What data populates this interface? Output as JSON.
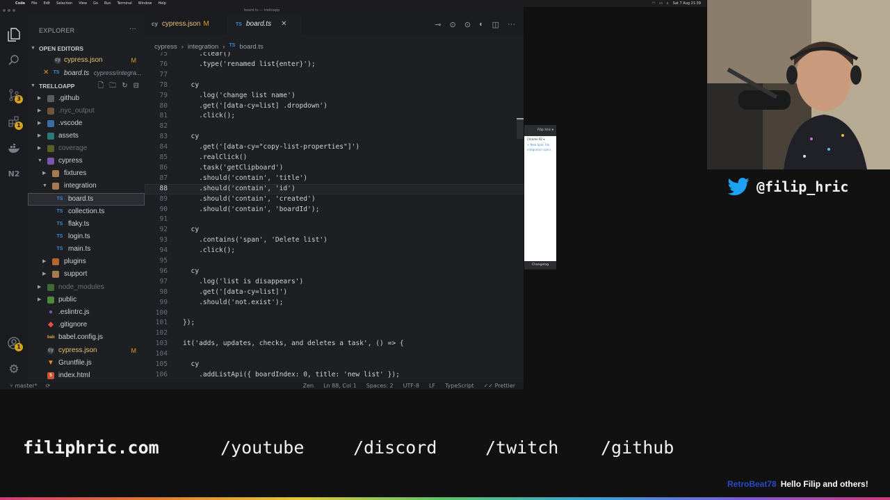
{
  "menubar": {
    "items": [
      "Code",
      "File",
      "Edit",
      "Selection",
      "View",
      "Go",
      "Run",
      "Terminal",
      "Window",
      "Help"
    ],
    "clock": "Sat 7 Aug 21:39"
  },
  "window_title": "board.ts — trelloapp",
  "sidebar": {
    "title": "EXPLORER",
    "open_editors_label": "OPEN EDITORS",
    "open_editors": [
      {
        "icon": "cy",
        "name": "cypress.json",
        "status": "M",
        "path": ""
      },
      {
        "icon": "TS",
        "name": "board.ts",
        "status": "",
        "path": "cypress/integra..."
      }
    ],
    "project_label": "TRELLOAPP",
    "tree": [
      {
        "name": ".github",
        "icon": "folder-github",
        "depth": 1,
        "type": "folder"
      },
      {
        "name": ".nyc_output",
        "icon": "folder",
        "depth": 1,
        "type": "folder"
      },
      {
        "name": ".vscode",
        "icon": "folder-vscode",
        "depth": 1,
        "type": "folder"
      },
      {
        "name": "assets",
        "icon": "folder-assets",
        "depth": 1,
        "type": "folder"
      },
      {
        "name": "coverage",
        "icon": "folder-coverage",
        "depth": 1,
        "type": "folder"
      },
      {
        "name": "cypress",
        "icon": "folder-cypress",
        "depth": 1,
        "type": "folder-open"
      },
      {
        "name": "fixtures",
        "icon": "folder",
        "depth": 2,
        "type": "folder"
      },
      {
        "name": "integration",
        "icon": "folder",
        "depth": 2,
        "type": "folder-open"
      },
      {
        "name": "board.ts",
        "icon": "TS",
        "depth": 3,
        "type": "file"
      },
      {
        "name": "collection.ts",
        "icon": "TS",
        "depth": 3,
        "type": "file"
      },
      {
        "name": "flaky.ts",
        "icon": "TS",
        "depth": 3,
        "type": "file"
      },
      {
        "name": "login.ts",
        "icon": "TS",
        "depth": 3,
        "type": "file"
      },
      {
        "name": "main.ts",
        "icon": "TS",
        "depth": 3,
        "type": "file"
      },
      {
        "name": "plugins",
        "icon": "folder-plugins",
        "depth": 2,
        "type": "folder"
      },
      {
        "name": "support",
        "icon": "folder",
        "depth": 2,
        "type": "folder"
      },
      {
        "name": "node_modules",
        "icon": "folder-node",
        "depth": 1,
        "type": "folder"
      },
      {
        "name": "public",
        "icon": "folder-public",
        "depth": 1,
        "type": "folder"
      },
      {
        "name": ".eslintrc.js",
        "icon": "eslint",
        "depth": 1,
        "type": "file"
      },
      {
        "name": ".gitignore",
        "icon": "git",
        "depth": 1,
        "type": "file"
      },
      {
        "name": "babel.config.js",
        "icon": "babel",
        "depth": 1,
        "type": "file"
      },
      {
        "name": "cypress.json",
        "icon": "cy",
        "depth": 1,
        "type": "file",
        "status": "M"
      },
      {
        "name": "Gruntfile.js",
        "icon": "grunt",
        "depth": 1,
        "type": "file"
      },
      {
        "name": "index.html",
        "icon": "html",
        "depth": 1,
        "type": "file"
      }
    ]
  },
  "tabs": [
    {
      "icon": "cy",
      "label": "cypress.json",
      "status": "M"
    },
    {
      "icon": "TS",
      "label": "board.ts",
      "close": "✕"
    }
  ],
  "breadcrumb": [
    "cypress",
    "integration",
    "TS",
    "board.ts"
  ],
  "code": [
    {
      "n": "75",
      "t": "    .clear()"
    },
    {
      "n": "76",
      "t": "    .type('renamed list{enter}');"
    },
    {
      "n": "77",
      "t": ""
    },
    {
      "n": "78",
      "t": "  cy"
    },
    {
      "n": "79",
      "t": "    .log('change list name')"
    },
    {
      "n": "80",
      "t": "    .get('[data-cy=list] .dropdown')"
    },
    {
      "n": "81",
      "t": "    .click();"
    },
    {
      "n": "82",
      "t": ""
    },
    {
      "n": "83",
      "t": "  cy"
    },
    {
      "n": "84",
      "t": "    .get('[data-cy=\"copy-list-properties\"]')"
    },
    {
      "n": "85",
      "t": "    .realClick()"
    },
    {
      "n": "86",
      "t": "    .task('getClipboard')"
    },
    {
      "n": "87",
      "t": "    .should('contain', 'title')"
    },
    {
      "n": "88",
      "t": "    .should('contain', 'id')"
    },
    {
      "n": "89",
      "t": "    .should('contain', 'created')"
    },
    {
      "n": "90",
      "t": "    .should('contain', 'boardId');"
    },
    {
      "n": "91",
      "t": ""
    },
    {
      "n": "92",
      "t": "  cy"
    },
    {
      "n": "93",
      "t": "    .contains('span', 'Delete list')"
    },
    {
      "n": "94",
      "t": "    .click();"
    },
    {
      "n": "95",
      "t": ""
    },
    {
      "n": "96",
      "t": "  cy"
    },
    {
      "n": "97",
      "t": "    .log('list is disappears')"
    },
    {
      "n": "98",
      "t": "    .get('[data-cy=list]')"
    },
    {
      "n": "99",
      "t": "    .should('not.exist');"
    },
    {
      "n": "100",
      "t": ""
    },
    {
      "n": "101",
      "t": "});"
    },
    {
      "n": "102",
      "t": ""
    },
    {
      "n": "103",
      "t": "it('adds, updates, checks, and deletes a task', () => {"
    },
    {
      "n": "104",
      "t": ""
    },
    {
      "n": "105",
      "t": "  cy"
    },
    {
      "n": "106",
      "t": "    .addListApi({ boardIndex: 0, title: 'new list' });"
    }
  ],
  "current_line": "88",
  "statusbar": {
    "branch": "master*",
    "sync": "⟳",
    "items": [
      "Zen",
      "Ln 88, Col 1",
      "Spaces: 2",
      "UTF-8",
      "LF",
      "TypeScript",
      "Prettier"
    ]
  },
  "preview": {
    "user": "Filip Hric ▾",
    "browser": "Chrome 92 ▾",
    "spec_link": "+ New Spec File",
    "spec_folder": "integration specs",
    "footer": "Changelog"
  },
  "overlay": {
    "twitter_handle": "@filip_hric",
    "links": [
      "filiphric.com",
      "/youtube",
      "/discord",
      "/twitch",
      "/github"
    ],
    "chat_user": "RetroBeat78",
    "chat_message": "Hello Filip and others!"
  },
  "colors": {
    "accent_badge": "#d9a21b",
    "ts_blue": "#3b8ad6",
    "twitter_blue": "#1da1f2"
  }
}
